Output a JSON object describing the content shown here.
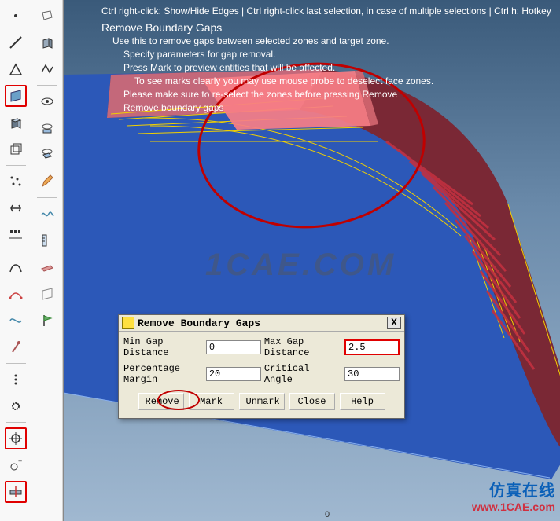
{
  "toolbar_left": [
    {
      "name": "point-icon"
    },
    {
      "name": "line-icon"
    },
    {
      "name": "triangle-icon"
    },
    {
      "name": "face-icon",
      "selected": true
    },
    {
      "name": "cube-icon"
    },
    {
      "name": "wire-cube-icon"
    },
    {
      "name": "scatter-icon"
    },
    {
      "name": "arrows-icon"
    },
    {
      "name": "align-icon"
    },
    {
      "name": "curve-icon"
    },
    {
      "name": "path-icon"
    },
    {
      "name": "spline-icon"
    },
    {
      "name": "needle-icon"
    },
    {
      "name": "dots-vert-icon"
    },
    {
      "name": "gear-icon"
    },
    {
      "name": "target-icon",
      "selected": true
    },
    {
      "name": "target-plus-icon"
    },
    {
      "name": "section-icon",
      "selected": true
    }
  ],
  "toolbar_right": [
    {
      "name": "wire-icon"
    },
    {
      "name": "box-icon"
    },
    {
      "name": "polyline-icon"
    },
    {
      "name": "eye-icon"
    },
    {
      "name": "eye-face-icon"
    },
    {
      "name": "eye-cube-icon"
    },
    {
      "name": "pencil-icon"
    },
    {
      "name": "wave-icon"
    },
    {
      "name": "ruler-icon"
    },
    {
      "name": "slab-icon"
    },
    {
      "name": "sheet-icon"
    },
    {
      "name": "flag-icon"
    }
  ],
  "hints": {
    "top": "Ctrl right-click: Show/Hide Edges | Ctrl right-click last selection, in case of multiple selections | Ctrl h: Hotkey",
    "title": "Remove Boundary Gaps",
    "l1": "Use this to remove gaps between selected zones and target zone.",
    "l2": "Specify parameters for gap removal.",
    "l3": "Press Mark to preview entities that will be affected.",
    "l4": "To see marks clearly you may use mouse probe to deselect face zones.",
    "l5": "Please make sure to re-select the zones before pressing Remove",
    "l6": "Remove boundary gaps"
  },
  "dialog": {
    "title": "Remove Boundary Gaps",
    "labels": {
      "min_gap": "Min Gap Distance",
      "max_gap": "Max Gap Distance",
      "pct": "Percentage Margin",
      "angle": "Critical Angle"
    },
    "values": {
      "min_gap": "0",
      "max_gap": "2.5",
      "pct": "20",
      "angle": "30"
    },
    "buttons": {
      "remove": "Remove",
      "mark": "Mark",
      "unmark": "Unmark",
      "close": "Close",
      "help": "Help"
    },
    "close_x": "X"
  },
  "watermark": {
    "center": "1CAE.COM",
    "chn": "仿真在线",
    "url": "www.1CAE.com"
  },
  "footer_zero": "0"
}
